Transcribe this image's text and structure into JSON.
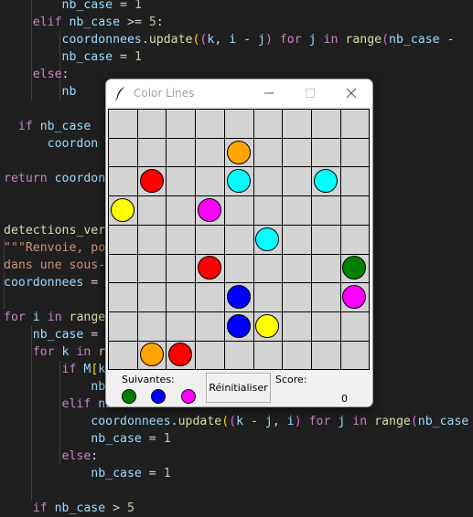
{
  "editor": {
    "lines": [
      [
        {
          "t": "op",
          "s": "        "
        },
        {
          "t": "id",
          "s": "nb_case"
        },
        {
          "t": "op",
          "s": " = "
        },
        {
          "t": "num",
          "s": "1"
        }
      ],
      [
        {
          "t": "op",
          "s": "    "
        },
        {
          "t": "kw",
          "s": "elif"
        },
        {
          "t": "op",
          "s": " "
        },
        {
          "t": "id",
          "s": "nb_case"
        },
        {
          "t": "op",
          "s": " >= "
        },
        {
          "t": "num",
          "s": "5"
        },
        {
          "t": "op",
          "s": ":"
        }
      ],
      [
        {
          "t": "op",
          "s": "        "
        },
        {
          "t": "id",
          "s": "coordonnees"
        },
        {
          "t": "op",
          "s": "."
        },
        {
          "t": "fn",
          "s": "update"
        },
        {
          "t": "br1",
          "s": "("
        },
        {
          "t": "br2",
          "s": "("
        },
        {
          "t": "id",
          "s": "k"
        },
        {
          "t": "op",
          "s": ", "
        },
        {
          "t": "id",
          "s": "i"
        },
        {
          "t": "op",
          "s": " - "
        },
        {
          "t": "id",
          "s": "j"
        },
        {
          "t": "br2",
          "s": ")"
        },
        {
          "t": "op",
          "s": " "
        },
        {
          "t": "kw",
          "s": "for"
        },
        {
          "t": "op",
          "s": " "
        },
        {
          "t": "id",
          "s": "j"
        },
        {
          "t": "op",
          "s": " "
        },
        {
          "t": "kw",
          "s": "in"
        },
        {
          "t": "op",
          "s": " "
        },
        {
          "t": "fn",
          "s": "range"
        },
        {
          "t": "br2",
          "s": "("
        },
        {
          "t": "id",
          "s": "nb_case"
        },
        {
          "t": "op",
          "s": " -"
        }
      ],
      [
        {
          "t": "op",
          "s": "        "
        },
        {
          "t": "id",
          "s": "nb_case"
        },
        {
          "t": "op",
          "s": " = "
        },
        {
          "t": "num",
          "s": "1"
        }
      ],
      [
        {
          "t": "op",
          "s": "    "
        },
        {
          "t": "kw",
          "s": "else"
        },
        {
          "t": "op",
          "s": ":"
        }
      ],
      [
        {
          "t": "op",
          "s": "        "
        },
        {
          "t": "id",
          "s": "nb"
        }
      ],
      [],
      [
        {
          "t": "op",
          "s": "  "
        },
        {
          "t": "kw",
          "s": "if"
        },
        {
          "t": "op",
          "s": " "
        },
        {
          "t": "id",
          "s": "nb_case"
        }
      ],
      [
        {
          "t": "op",
          "s": "      "
        },
        {
          "t": "id",
          "s": "coordon"
        },
        {
          "t": "op",
          "s": "                "
        },
        {
          "t": "fn",
          "s": "ange"
        },
        {
          "t": "br2",
          "s": "("
        },
        {
          "t": "id",
          "s": "nb_case"
        },
        {
          "t": "op",
          "s": " -"
        }
      ],
      [],
      [
        {
          "t": "ret",
          "s": "return"
        },
        {
          "t": "op",
          "s": " "
        },
        {
          "t": "id",
          "s": "coordonn"
        }
      ],
      [],
      [],
      [
        {
          "t": "fn",
          "s": "detections_vert"
        }
      ],
      [
        {
          "t": "str",
          "s": "\"\"\"Renvoie, pou"
        },
        {
          "t": "op",
          "s": "                    "
        },
        {
          "t": "str",
          "s": "es des cases co"
        }
      ],
      [
        {
          "t": "str",
          "s": "dans une sous-c"
        }
      ],
      [
        {
          "t": "id",
          "s": "coordonnees"
        },
        {
          "t": "op",
          "s": " = "
        },
        {
          "t": "id",
          "s": "s"
        }
      ],
      [],
      [
        {
          "t": "kw",
          "s": "for"
        },
        {
          "t": "op",
          "s": " "
        },
        {
          "t": "id",
          "s": "i"
        },
        {
          "t": "op",
          "s": " "
        },
        {
          "t": "kw",
          "s": "in"
        },
        {
          "t": "op",
          "s": " "
        },
        {
          "t": "fn",
          "s": "range"
        },
        {
          "t": "br1",
          "s": "("
        }
      ],
      [
        {
          "t": "op",
          "s": "    "
        },
        {
          "t": "id",
          "s": "nb_case"
        },
        {
          "t": "op",
          "s": " = "
        },
        {
          "t": "num",
          "s": "1"
        }
      ],
      [
        {
          "t": "op",
          "s": "    "
        },
        {
          "t": "kw",
          "s": "for"
        },
        {
          "t": "op",
          "s": " "
        },
        {
          "t": "id",
          "s": "k"
        },
        {
          "t": "op",
          "s": " "
        },
        {
          "t": "kw",
          "s": "in"
        },
        {
          "t": "op",
          "s": " "
        },
        {
          "t": "fn",
          "s": "ra"
        }
      ],
      [
        {
          "t": "op",
          "s": "        "
        },
        {
          "t": "kw",
          "s": "if"
        },
        {
          "t": "op",
          "s": " "
        },
        {
          "t": "id",
          "s": "M"
        },
        {
          "t": "br1",
          "s": "["
        },
        {
          "t": "id",
          "s": "k"
        },
        {
          "t": "br1",
          "s": "]"
        },
        {
          "t": "op",
          "s": "                        "
        },
        {
          "t": "const",
          "s": "None"
        },
        {
          "t": "op",
          "s": ":"
        }
      ],
      [
        {
          "t": "op",
          "s": "            "
        },
        {
          "t": "id",
          "s": "nb"
        }
      ],
      [
        {
          "t": "op",
          "s": "        "
        },
        {
          "t": "kw",
          "s": "elif"
        },
        {
          "t": "op",
          "s": " "
        },
        {
          "t": "id",
          "s": "nb"
        }
      ],
      [
        {
          "t": "op",
          "s": "            "
        },
        {
          "t": "id",
          "s": "coordonnees"
        },
        {
          "t": "op",
          "s": "."
        },
        {
          "t": "fn",
          "s": "update"
        },
        {
          "t": "br1",
          "s": "("
        },
        {
          "t": "br2",
          "s": "("
        },
        {
          "t": "id",
          "s": "k"
        },
        {
          "t": "op",
          "s": " - "
        },
        {
          "t": "id",
          "s": "j"
        },
        {
          "t": "op",
          "s": ", "
        },
        {
          "t": "id",
          "s": "i"
        },
        {
          "t": "br2",
          "s": ")"
        },
        {
          "t": "op",
          "s": " "
        },
        {
          "t": "kw",
          "s": "for"
        },
        {
          "t": "op",
          "s": " "
        },
        {
          "t": "id",
          "s": "j"
        },
        {
          "t": "op",
          "s": " "
        },
        {
          "t": "kw",
          "s": "in"
        },
        {
          "t": "op",
          "s": " "
        },
        {
          "t": "fn",
          "s": "range"
        },
        {
          "t": "br2",
          "s": "("
        },
        {
          "t": "id",
          "s": "nb_case"
        },
        {
          "t": "op",
          "s": " -"
        }
      ],
      [
        {
          "t": "op",
          "s": "            "
        },
        {
          "t": "id",
          "s": "nb_case"
        },
        {
          "t": "op",
          "s": " = "
        },
        {
          "t": "num",
          "s": "1"
        }
      ],
      [
        {
          "t": "op",
          "s": "        "
        },
        {
          "t": "kw",
          "s": "else"
        },
        {
          "t": "op",
          "s": ":"
        }
      ],
      [
        {
          "t": "op",
          "s": "            "
        },
        {
          "t": "id",
          "s": "nb_case"
        },
        {
          "t": "op",
          "s": " = "
        },
        {
          "t": "num",
          "s": "1"
        }
      ],
      [],
      [
        {
          "t": "op",
          "s": "    "
        },
        {
          "t": "kw",
          "s": "if"
        },
        {
          "t": "op",
          "s": " "
        },
        {
          "t": "id",
          "s": "nb_case"
        },
        {
          "t": "op",
          "s": " > "
        },
        {
          "t": "num",
          "s": "5"
        }
      ]
    ]
  },
  "window": {
    "title": "Color Lines",
    "icon": "feather-icon",
    "controls": [
      "minimize-icon",
      "maximize-icon",
      "close-icon"
    ]
  },
  "board": {
    "rows": 9,
    "cols": 9,
    "background": "#d3d3d3",
    "balls": [
      {
        "row": 1,
        "col": 4,
        "color": "#ffa500"
      },
      {
        "row": 2,
        "col": 1,
        "color": "#ff0000"
      },
      {
        "row": 2,
        "col": 4,
        "color": "#00ffff"
      },
      {
        "row": 2,
        "col": 7,
        "color": "#00ffff"
      },
      {
        "row": 3,
        "col": 0,
        "color": "#ffff00"
      },
      {
        "row": 3,
        "col": 3,
        "color": "#ff00ff"
      },
      {
        "row": 4,
        "col": 5,
        "color": "#00ffff"
      },
      {
        "row": 5,
        "col": 3,
        "color": "#ff0000"
      },
      {
        "row": 5,
        "col": 8,
        "color": "#008000"
      },
      {
        "row": 6,
        "col": 4,
        "color": "#0000ff"
      },
      {
        "row": 6,
        "col": 8,
        "color": "#ff00ff"
      },
      {
        "row": 7,
        "col": 4,
        "color": "#0000ff"
      },
      {
        "row": 7,
        "col": 5,
        "color": "#ffff00"
      },
      {
        "row": 8,
        "col": 1,
        "color": "#ffa500"
      },
      {
        "row": 8,
        "col": 2,
        "color": "#ff0000"
      }
    ]
  },
  "footer": {
    "next_label": "Suivantes:",
    "next_colors": [
      "#008000",
      "#0000ff",
      "#ff00ff"
    ],
    "reset_label": "Réinitialiser",
    "score_label": "Score:",
    "score_value": "0"
  }
}
